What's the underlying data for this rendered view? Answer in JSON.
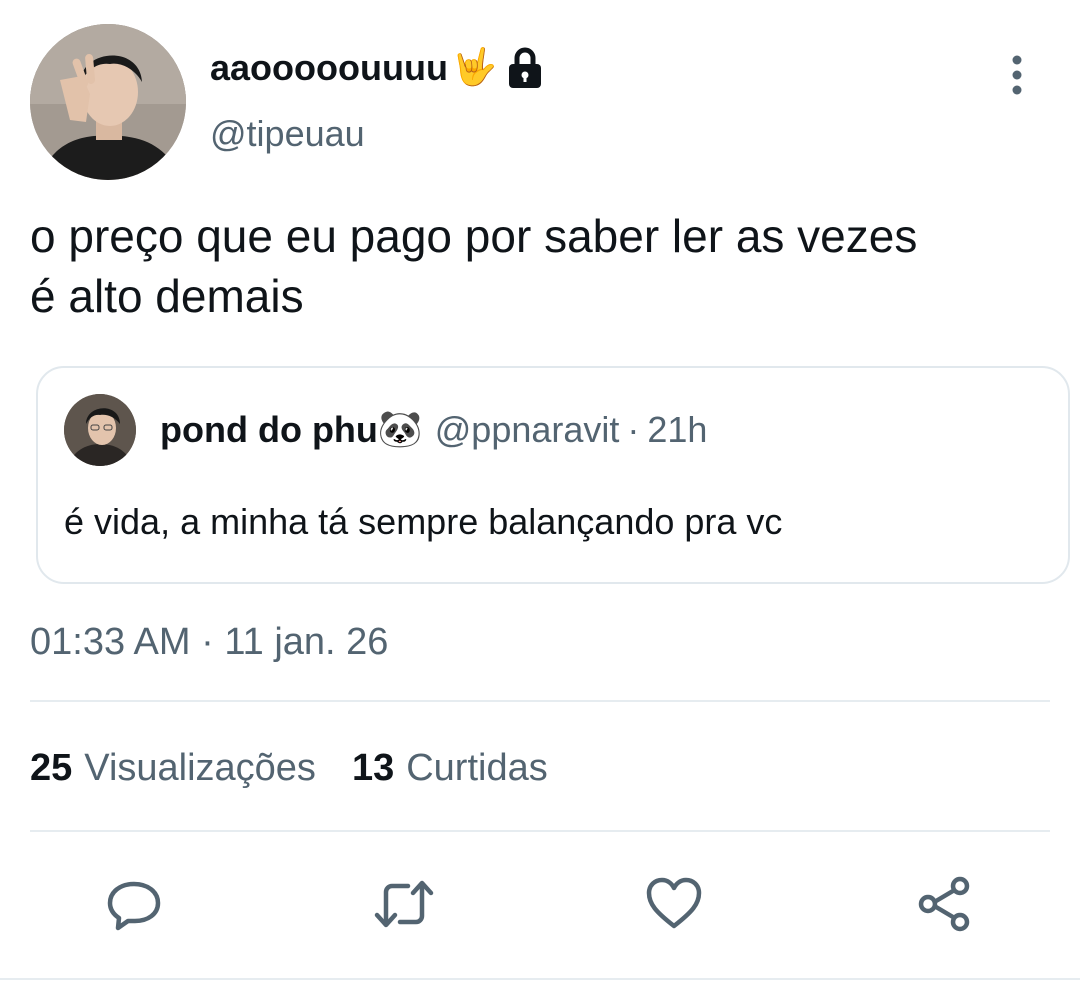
{
  "tweet": {
    "display_name": "aaooooouuuu",
    "display_name_emoji": "🤟",
    "handle": "@tipeuau",
    "text_line1": "o preço que eu pago por saber ler as vezes",
    "text_line2": "é alto demais",
    "timestamp": "01:33 AM · 11 jan. 26"
  },
  "quote": {
    "display_name": "pond do phu",
    "display_name_emoji": "🐼",
    "handle": "@ppnaravit",
    "separator": "·",
    "time": "21h",
    "text": "é vida, a minha tá sempre balançando pra vc"
  },
  "stats": {
    "views_count": "25",
    "views_label": "Visualizações",
    "likes_count": "13",
    "likes_label": "Curtidas"
  },
  "icons": {
    "lock": "lock-icon",
    "more": "more-vertical-icon",
    "reply": "reply-icon",
    "retweet": "retweet-icon",
    "like": "heart-icon",
    "share": "share-icon"
  },
  "colors": {
    "text_primary": "#0f1419",
    "text_secondary": "#536471",
    "border": "#e1e8ed"
  }
}
